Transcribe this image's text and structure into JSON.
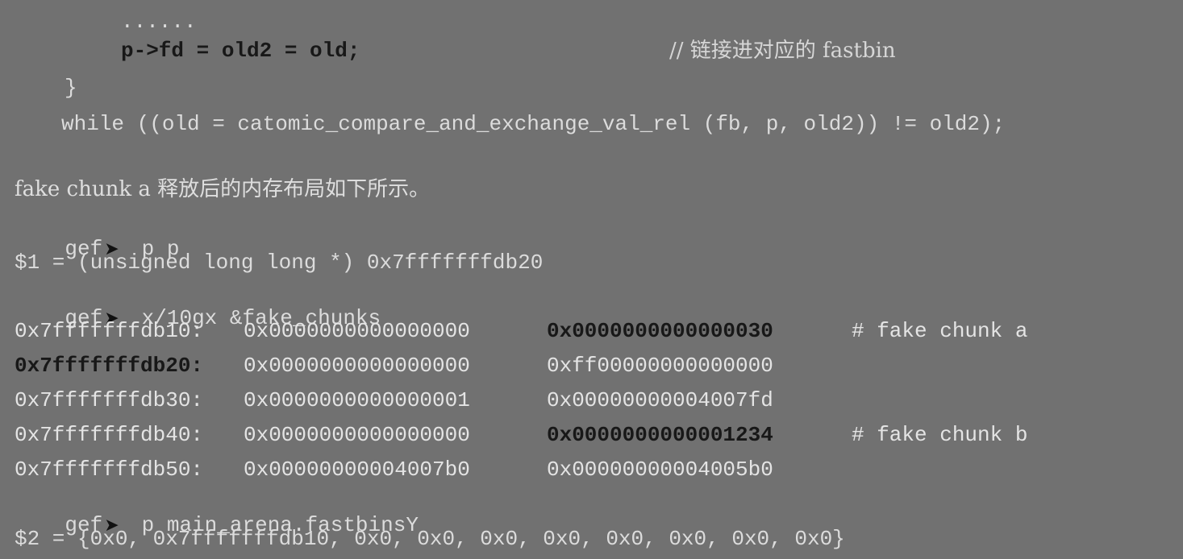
{
  "code": {
    "dots": "......",
    "assign_line": "p->fd = old2 = old;",
    "assign_comment": "// 链接进对应的 fastbin",
    "close_brace": "}",
    "while_line": "while ((old = catomic_compare_and_exchange_val_rel (fb, p, old2)) != old2);"
  },
  "prose": {
    "text": "fake chunk a 释放后的内存布局如下所示。"
  },
  "terminal": {
    "prompt_label": "gef",
    "prompt_arrow": "➤",
    "cmd1": "p p",
    "out1": "$1 = (unsigned long long *) 0x7fffffffdb20",
    "cmd2": "x/10gx &fake_chunks",
    "memory_rows": [
      {
        "addr": "0x7fffffffdb10:",
        "v1": "0x0000000000000000",
        "v2": "0x0000000000000030",
        "comment": "# fake chunk a"
      },
      {
        "addr": "0x7fffffffdb20:",
        "v1": "0x0000000000000000",
        "v2": "0xff00000000000000",
        "comment": ""
      },
      {
        "addr": "0x7fffffffdb30:",
        "v1": "0x0000000000000001",
        "v2": "0x00000000004007fd",
        "comment": ""
      },
      {
        "addr": "0x7fffffffdb40:",
        "v1": "0x0000000000000000",
        "v2": "0x0000000000001234",
        "comment": "# fake chunk b"
      },
      {
        "addr": "0x7fffffffdb50:",
        "v1": "0x00000000004007b0",
        "v2": "0x00000000004005b0",
        "comment": ""
      }
    ],
    "cmd3": "p main_arena.fastbinsY",
    "out3": "$2 = {0x0, 0x7fffffffdb10, 0x0, 0x0, 0x0, 0x0, 0x0, 0x0, 0x0, 0x0}"
  },
  "icons": {
    "prompt_arrow_icon": "right-pointing-triangle"
  }
}
